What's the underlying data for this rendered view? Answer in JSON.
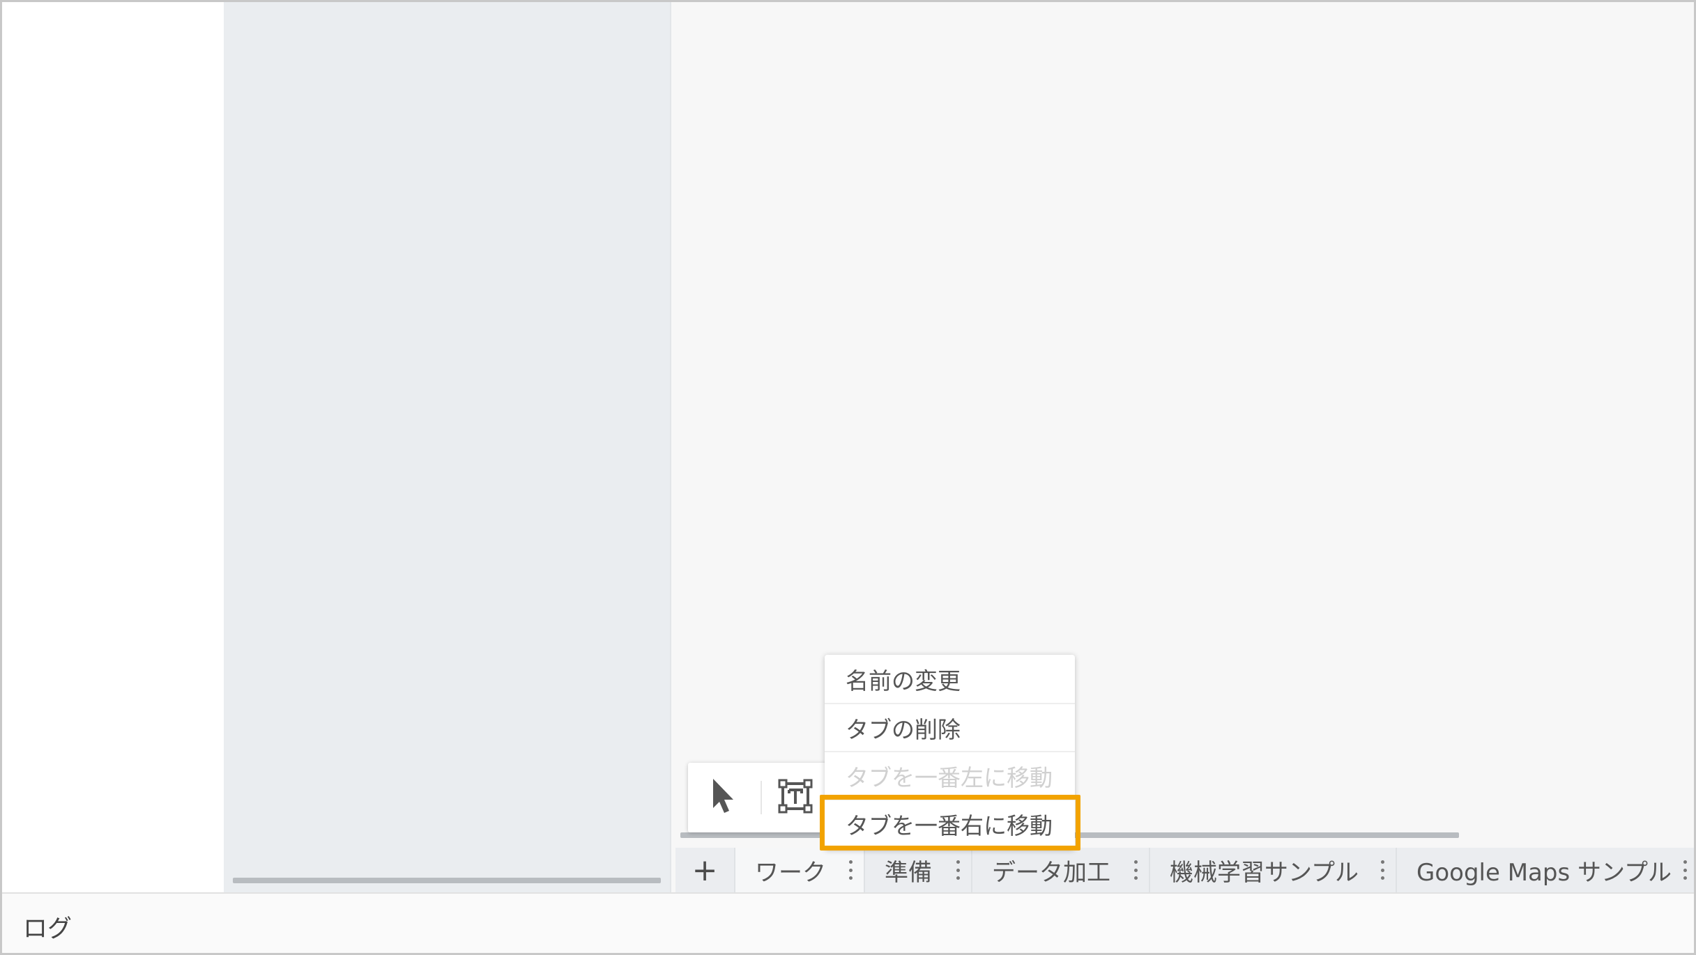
{
  "tabs": {
    "add_label": "+",
    "items": [
      {
        "label": "ワーク",
        "active": true
      },
      {
        "label": "準備",
        "active": false
      },
      {
        "label": "データ加工",
        "active": false
      },
      {
        "label": "機械学習サンプル",
        "active": false
      },
      {
        "label": "Google Maps サンプル",
        "active": false
      }
    ]
  },
  "context_menu": {
    "items": [
      {
        "label": "名前の変更",
        "enabled": true
      },
      {
        "label": "タブの削除",
        "enabled": true
      },
      {
        "label": "タブを一番左に移動",
        "enabled": false
      },
      {
        "label": "タブを一番右に移動",
        "enabled": true,
        "highlighted": true
      }
    ]
  },
  "toolbar": {
    "select_icon": "pointer-arrow-icon",
    "text_icon": "text-box-icon"
  },
  "log": {
    "label": "ログ"
  },
  "colors": {
    "highlight": "#f2a300",
    "mid_pane_bg": "#eaedf0",
    "canvas_bg": "#f7f7f7",
    "tabbar_bg": "#ebedf0"
  }
}
